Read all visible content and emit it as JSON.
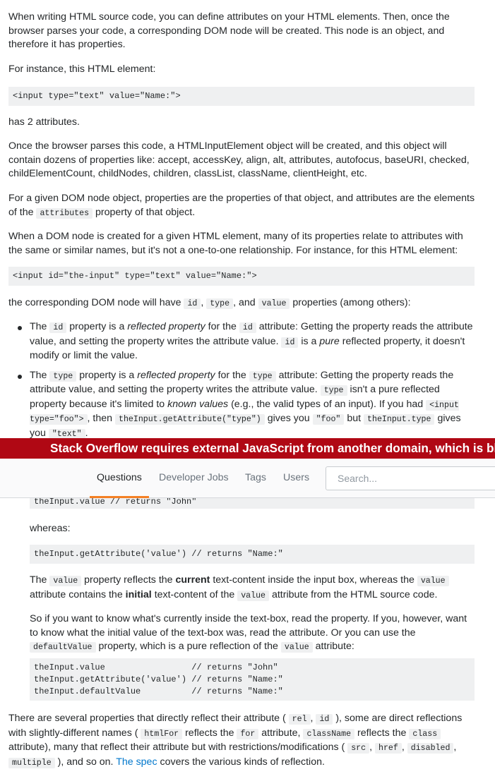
{
  "answer": {
    "p1": "When writing HTML source code, you can define attributes on your HTML elements. Then, once the browser parses your code, a corresponding DOM node will be created. This node is an object, and therefore it has properties.",
    "p2": "For instance, this HTML element:",
    "code1": "<input type=\"text\" value=\"Name:\">",
    "p3": "has 2 attributes.",
    "p4": "Once the browser parses this code, a HTMLInputElement object will be created, and this object will contain dozens of properties like: accept, accessKey, align, alt, attributes, autofocus, baseURI, checked, childElementCount, childNodes, children, classList, className, clientHeight, etc.",
    "p5": {
      "a": "For a given DOM node object, properties are the properties of that object, and attributes are the elements of the",
      "code": "attributes",
      "b": "property of that object."
    },
    "p6": "When a DOM node is created for a given HTML element, many of its properties relate to attributes with the same or similar names, but it's not a one-to-one relationship. For instance, for this HTML element:",
    "code2": "<input id=\"the-input\" type=\"text\" value=\"Name:\">",
    "p7": {
      "a": "the corresponding DOM node will have",
      "c1": "id",
      "sep1": ",",
      "c2": "type",
      "sep2": ", and",
      "c3": "value",
      "b": "properties (among others):"
    },
    "bullet1": {
      "a": "The",
      "c1": "id",
      "b": "property is a",
      "em": "reflected property",
      "c": "for the",
      "c2": "id",
      "d": "attribute: Getting the property reads the attribute value, and setting the property writes the attribute value.",
      "c3": "id",
      "e": "is a",
      "em2": "pure",
      "f": "reflected property, it doesn't modify or limit the value."
    },
    "bullet2": {
      "a": "The",
      "c1": "type",
      "b": "property is a",
      "em": "reflected property",
      "c": "for the",
      "c2": "type",
      "d": "attribute: Getting the property reads the attribute value, and setting the property writes the attribute value.",
      "c3": "type",
      "e": "isn't a pure reflected property because it's limited to",
      "em2": "known values",
      "f": "(e.g., the valid types of an input). If you had",
      "c4": "<input type=\"foo\">",
      "g": ", then",
      "c5": "theInput.getAttribute(\"type\")",
      "h": "gives you",
      "c6": "\"foo\"",
      "i": "but",
      "c7": "theInput.type",
      "j": "gives you",
      "c8": "\"text\"",
      "k": "."
    },
    "code3_partial": "theInput.value // returns \"John\"",
    "whereas": "whereas:",
    "code4": "theInput.getAttribute('value') // returns \"Name:\"",
    "p8": {
      "a": "The",
      "c1": "value",
      "b": "property reflects the",
      "strong1": "current",
      "c": "text-content inside the input box, whereas the",
      "c2": "value",
      "d": "attribute contains the",
      "strong2": "initial",
      "e": "text-content of the",
      "c3": "value",
      "f": "attribute from the HTML source code."
    },
    "p9": {
      "a": "So if you want to know what's currently inside the text-box, read the property. If you, however, want to know what the initial value of the text-box was, read the attribute. Or you can use the",
      "c1": "defaultValue",
      "b": "property, which is a pure reflection of the",
      "c2": "value",
      "c": "attribute:"
    },
    "code5": "theInput.value                 // returns \"John\"\ntheInput.getAttribute('value') // returns \"Name:\"\ntheInput.defaultValue          // returns \"Name:\"",
    "p10": {
      "a": "There are several properties that directly reflect their attribute (",
      "c1": "rel",
      "s1": ",",
      "c2": "id",
      "b": "), some are direct reflections with slightly-different names (",
      "c3": "htmlFor",
      "c": "reflects the",
      "c4": "for",
      "d": "attribute,",
      "c5": "className",
      "e": "reflects the",
      "c6": "class",
      "f": "attribute), many that reflect their attribute but with restrictions/modifications (",
      "c7": "src",
      "s2": ",",
      "c8": "href",
      "s3": ",",
      "c9": "disabled",
      "s4": ",",
      "c10": "multiple",
      "g": "), and so on.",
      "link": "The spec",
      "h": "covers the various kinds of reflection."
    }
  },
  "banner": {
    "text": "Stack Overflow requires external JavaScript from another domain, which is blocked or failed to load."
  },
  "navbar": {
    "questions": "Questions",
    "jobs": "Developer Jobs",
    "tags": "Tags",
    "users": "Users",
    "search_placeholder": "Search..."
  },
  "colors": {
    "banner": "#b00814",
    "accent": "#f48024",
    "link": "#0077cc",
    "code_bg": "#eff0f1"
  }
}
